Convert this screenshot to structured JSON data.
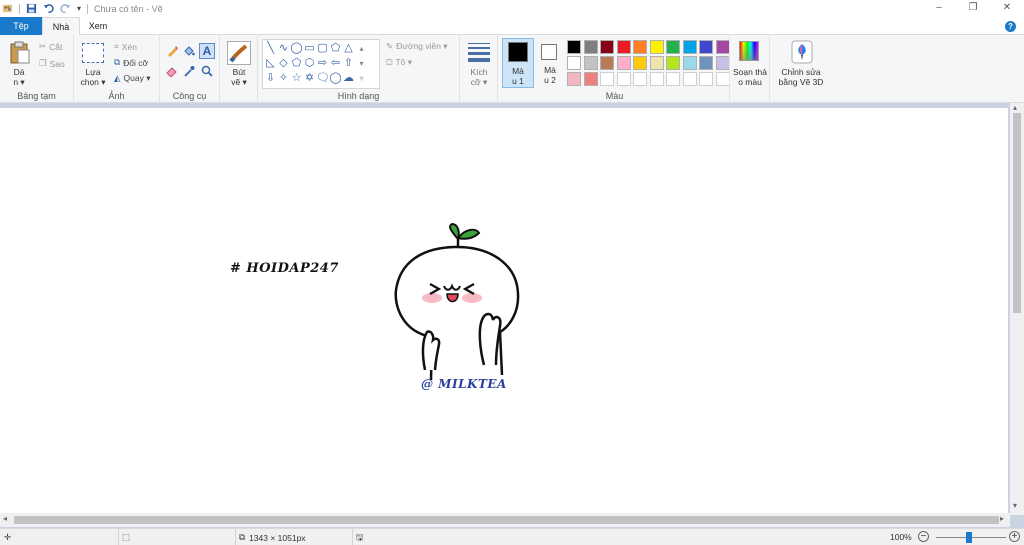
{
  "window": {
    "title": "Chưa có tên - Vẽ",
    "controls": [
      "–",
      "❐",
      "✕"
    ]
  },
  "tabs": {
    "file": "Tệp",
    "home": "Nhà",
    "view": "Xem"
  },
  "ribbon": {
    "clipboard": {
      "paste": "Dá",
      "paste2": "n ▾",
      "cut": "Cắt",
      "copy": "Sao",
      "label": "Bảng tạm"
    },
    "image": {
      "select": "Lựa",
      "select2": "chọn ▾",
      "crop": "Xén",
      "resize": "Đổi cỡ",
      "rotate": "Quay ▾",
      "label": "Ảnh"
    },
    "tools": {
      "label": "Công cụ"
    },
    "brushes": {
      "label": "Bút",
      "label2": "vẽ ▾"
    },
    "shapes": {
      "outline": "Đường viền ▾",
      "fill": "Tô ▾",
      "label": "Hình dạng"
    },
    "size": {
      "label": "Kích",
      "label2": "cỡ ▾"
    },
    "color1": {
      "label": "Mà",
      "label2": "u 1",
      "value": "#000000"
    },
    "color2": {
      "label": "Mà",
      "label2": "u 2",
      "value": "#ffffff"
    },
    "colors_label": "Màu",
    "edit_colors": {
      "label": "Soạn thả",
      "label2": "o màu"
    },
    "paint3d": {
      "label": "Chỉnh sửa",
      "label2": "bằng Vẽ 3D"
    }
  },
  "palette": [
    "#000000",
    "#7f7f7f",
    "#880015",
    "#ed1c24",
    "#ff7f27",
    "#fff200",
    "#22b14c",
    "#00a2e8",
    "#3f48cc",
    "#a349a4",
    "#ffffff",
    "#c3c3c3",
    "#b97a57",
    "#ffaec9",
    "#ffc90e",
    "#efe4b0",
    "#b5e61d",
    "#99d9ea",
    "#7092be",
    "#c8bfe7",
    "#f4b6c2",
    "#f08080",
    "#ffffff",
    "#ffffff",
    "#ffffff",
    "#ffffff",
    "#ffffff",
    "#ffffff",
    "#ffffff",
    "#ffffff"
  ],
  "canvas": {
    "hashtag": "# HOIDAP247",
    "signature": "@ MILKTEA"
  },
  "status": {
    "dimensions": "1343 × 1051px",
    "zoom": "100%"
  }
}
